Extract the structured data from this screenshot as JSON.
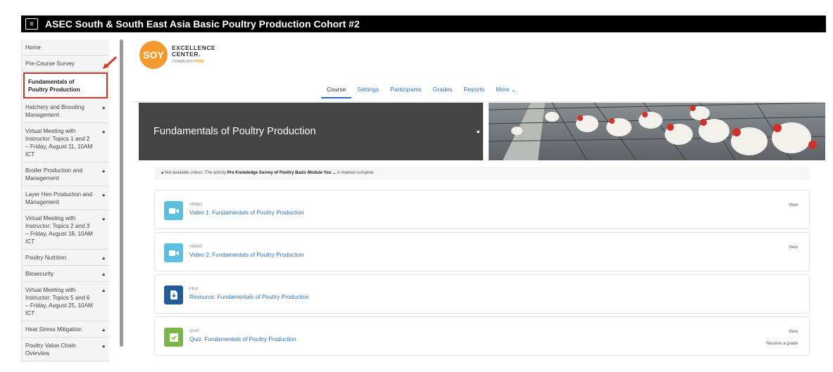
{
  "header": {
    "title": "ASEC South & South East Asia Basic Poultry Production Cohort #2",
    "menu_icon": "hamburger-icon"
  },
  "sidebar": {
    "items": [
      {
        "label": "Home",
        "locked": false,
        "active": false
      },
      {
        "label": "Pre-Course Survey",
        "locked": false,
        "active": false
      },
      {
        "label": "Fundamentals of Poultry Production",
        "locked": false,
        "active": true
      },
      {
        "label": "Hatchery and Brooding Management",
        "locked": true,
        "active": false
      },
      {
        "label": "Virtual Meeting with Instructor: Topics 1 and 2 – Friday, August 11, 10AM ICT",
        "locked": true,
        "active": false
      },
      {
        "label": "Broiler Production and Management",
        "locked": true,
        "active": false
      },
      {
        "label": "Layer Hen Production and Management",
        "locked": true,
        "active": false
      },
      {
        "label": "Virtual Meeting with Instructor: Topics 2 and 3 – Friday, August 18, 10AM ICT",
        "locked": true,
        "active": false
      },
      {
        "label": "Poultry Nutrition",
        "locked": true,
        "active": false
      },
      {
        "label": "Biosecurity",
        "locked": true,
        "active": false
      },
      {
        "label": "Virtual Meeting with Instructor: Topics 5 and 6 – Friday, August 25, 10AM ICT",
        "locked": true,
        "active": false
      },
      {
        "label": "Heat Stress Mitigation",
        "locked": true,
        "active": false
      },
      {
        "label": "Poultry Value Chain Overview",
        "locked": true,
        "active": false
      }
    ]
  },
  "logo": {
    "badge": "SOY",
    "line1": "EXCELLENCE",
    "line2": "CENTER.",
    "line3a": "COMMUNITY",
    "line3b": "POD"
  },
  "tabs": [
    {
      "label": "Course",
      "active": true
    },
    {
      "label": "Settings",
      "active": false
    },
    {
      "label": "Participants",
      "active": false
    },
    {
      "label": "Grades",
      "active": false
    },
    {
      "label": "Reports",
      "active": false
    },
    {
      "label": "More ⌄",
      "active": false
    }
  ],
  "section": {
    "title": "Fundamentals of Poultry Production"
  },
  "restriction": {
    "prefix": "Not available unless: The activity ",
    "activity": "Pre Knowledge Survey of Poultry Basic Module You ...",
    "suffix": " is marked complete"
  },
  "activities": [
    {
      "kind": "VIDEO",
      "name": "Video 1: Fundamentals of Poultry Production",
      "view": "View",
      "grade": "",
      "color": "#5bc0de",
      "icon": "video-icon"
    },
    {
      "kind": "VIDEO",
      "name": "Video 2: Fundamentals of Poultry Production",
      "view": "View",
      "grade": "",
      "color": "#5bc0de",
      "icon": "video-icon"
    },
    {
      "kind": "FILE",
      "name": "Resource: Fundamentals of Poultry Production",
      "view": "",
      "grade": "",
      "color": "#1f5c99",
      "icon": "file-icon"
    },
    {
      "kind": "QUIZ",
      "name": "Quiz: Fundamentals of Poultry Production",
      "view": "View",
      "grade": "Receive a grade",
      "color": "#7ab648",
      "icon": "quiz-icon"
    }
  ],
  "colors": {
    "accent": "#2f6fb5",
    "highlight_border": "#c0392b",
    "banner_bg": "#444444",
    "logo_orange": "#f29a2e"
  }
}
